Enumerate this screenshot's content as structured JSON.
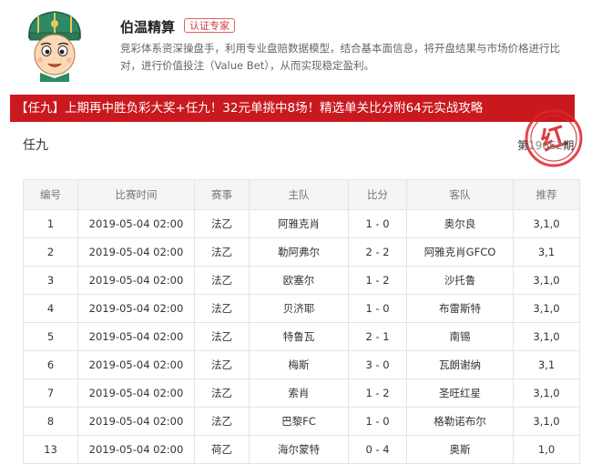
{
  "profile": {
    "name": "伯温精算",
    "badge": "认证专家",
    "description": "竞彩体系资深操盘手，利用专业盘赔数据模型，结合基本面信息，将开盘结果与市场价格进行比对，进行价值投注（Value Bet），从而实现稳定盈利。",
    "avatar_icon": "cartoon-man-green-hat-avatar"
  },
  "banner": {
    "text": "【任九】上期再中胜负彩大奖+任九！32元单挑中8场！精选单关比分附64元实战攻略"
  },
  "stamp": {
    "text": "红"
  },
  "section": {
    "title": "任九",
    "issue_prefix": "第",
    "issue_number": "19062",
    "issue_suffix": "期"
  },
  "colors": {
    "banner_bg": "#c9191f",
    "badge_border": "#e06060",
    "stamp_red": "#d8272d",
    "header_bg": "#f5f5f5"
  },
  "table": {
    "headers": [
      "编号",
      "比赛时间",
      "赛事",
      "主队",
      "比分",
      "客队",
      "推荐"
    ],
    "rows": [
      [
        "1",
        "2019-05-04 02:00",
        "法乙",
        "阿雅克肖",
        "1 - 0",
        "奥尔良",
        "3,1,0"
      ],
      [
        "2",
        "2019-05-04 02:00",
        "法乙",
        "勒阿弗尔",
        "2 - 2",
        "阿雅克肖GFCO",
        "3,1"
      ],
      [
        "3",
        "2019-05-04 02:00",
        "法乙",
        "欧塞尔",
        "1 - 2",
        "沙托鲁",
        "3,1,0"
      ],
      [
        "4",
        "2019-05-04 02:00",
        "法乙",
        "贝济耶",
        "1 - 0",
        "布雷斯特",
        "3,1,0"
      ],
      [
        "5",
        "2019-05-04 02:00",
        "法乙",
        "特鲁瓦",
        "2 - 1",
        "南锡",
        "3,1,0"
      ],
      [
        "6",
        "2019-05-04 02:00",
        "法乙",
        "梅斯",
        "3 - 0",
        "瓦朗谢纳",
        "3,1"
      ],
      [
        "7",
        "2019-05-04 02:00",
        "法乙",
        "索肖",
        "1 - 2",
        "圣旺红星",
        "3,1,0"
      ],
      [
        "8",
        "2019-05-04 02:00",
        "法乙",
        "巴黎FC",
        "1 - 0",
        "格勒诺布尔",
        "3,1,0"
      ],
      [
        "13",
        "2019-05-04 02:00",
        "荷乙",
        "海尔蒙特",
        "0 - 4",
        "奥斯",
        "1,0"
      ]
    ]
  }
}
